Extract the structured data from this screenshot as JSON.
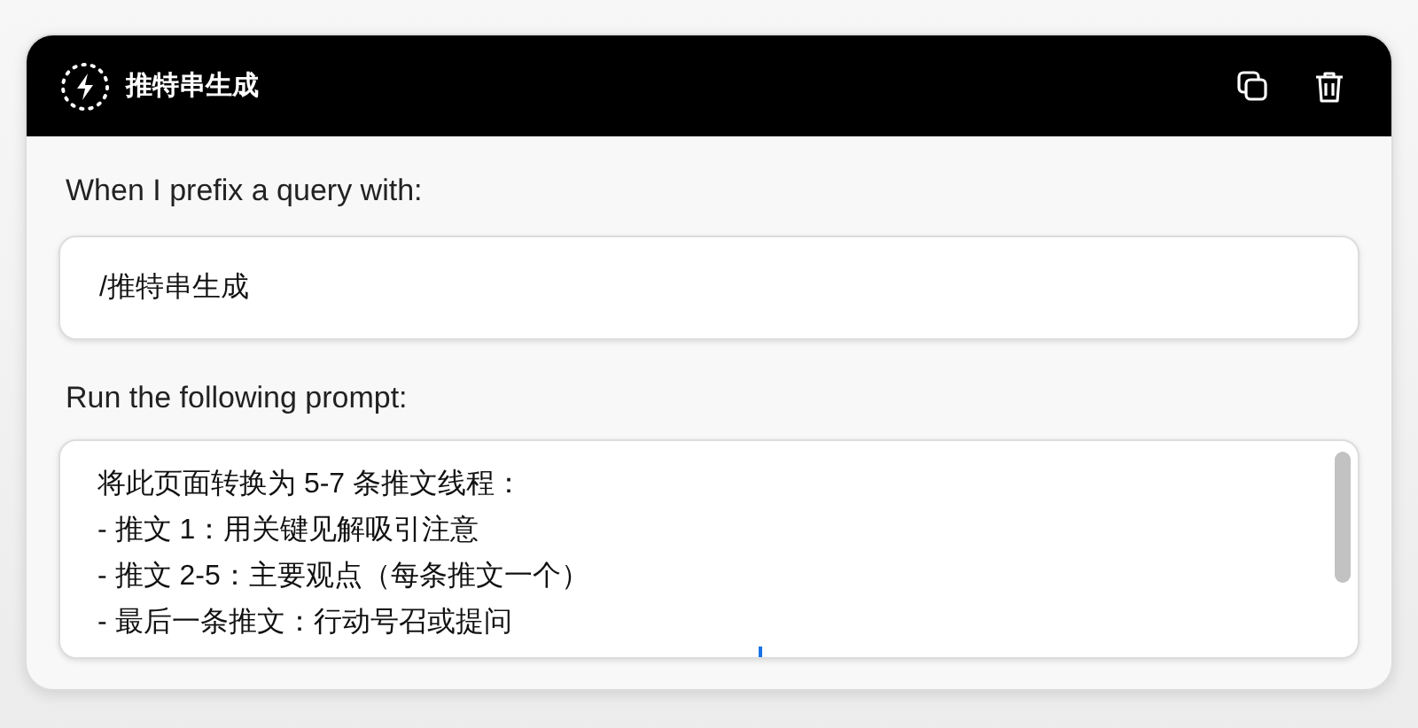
{
  "header": {
    "title": "推特串生成"
  },
  "prefix": {
    "label": "When I prefix a query with:",
    "value": "/推特串生成"
  },
  "prompt": {
    "label": "Run the following prompt:",
    "lines": [
      "将此页面转换为 5-7 条推文线程：",
      "- 推文 1：用关键见解吸引注意",
      "- 推文 2-5：主要观点（每条推文一个）",
      "- 最后一条推文：行动号召或提问"
    ]
  }
}
